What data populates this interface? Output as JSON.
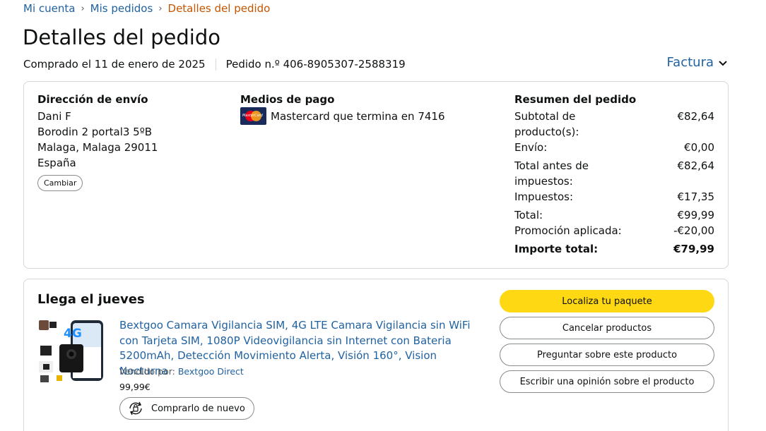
{
  "breadcrumb": {
    "items": [
      "Mi cuenta",
      "Mis pedidos"
    ],
    "separator": "›",
    "current": "Detalles del pedido"
  },
  "page": {
    "title": "Detalles del pedido",
    "purchased": "Comprado el 11 de enero de 2025",
    "order_number": "Pedido n.º 406-8905307-2588319",
    "invoice_label": "Factura"
  },
  "shipping": {
    "title": "Dirección de envío",
    "name": "Dani F",
    "street": "Borodin 2 portal3 5ºB",
    "city": "Malaga, Malaga 29011",
    "country": "España",
    "change_label": "Cambiar"
  },
  "payment": {
    "title": "Medios de pago",
    "card_brand_text": "MasterCard",
    "card": "Mastercard  que termina en 7416"
  },
  "summary": {
    "title": "Resumen del pedido",
    "rows": [
      {
        "label": "Subtotal de producto(s):",
        "value": "€82,64"
      },
      {
        "label": "Envío:",
        "value": "€0,00"
      },
      {
        "label": "Total antes de impuestos:",
        "value": "€82,64"
      },
      {
        "label": "Impuestos:",
        "value": "€17,35"
      },
      {
        "label": "Total:",
        "value": "€99,99"
      },
      {
        "label": "Promoción aplicada:",
        "value": "-€20,00"
      },
      {
        "label": "Importe total:",
        "value": "€79,99"
      }
    ]
  },
  "shipment": {
    "title": "Llega el jueves",
    "product_title": "Bextgoo Camara Vigilancia SIM, 4G LTE Camara Vigilancia sin WiFi con Tarjeta SIM, 1080P Videovigilancia sin Internet con Bateria 5200mAh, Detección Movimiento Alerta, Visión 160°, Vision Nocturna",
    "sold_by_label": "Vendido por:",
    "seller": "Bextgoo Direct",
    "price": "99,99€",
    "image_badge": "4G",
    "rebuy_label": "Comprarlo de nuevo",
    "actions": [
      "Localiza tu paquete",
      "Cancelar productos",
      "Preguntar sobre este producto",
      "Escribir una opinión sobre el producto"
    ]
  },
  "colors": {
    "link": "#2162a1",
    "breadcrumb_current": "#c45500",
    "primary_button": "#ffd814",
    "border": "#d5d9d9"
  },
  "icons": {
    "invoice": "chevron-down-icon",
    "rebuy": "reorder-cycle-icon",
    "payment": "mastercard-icon"
  }
}
